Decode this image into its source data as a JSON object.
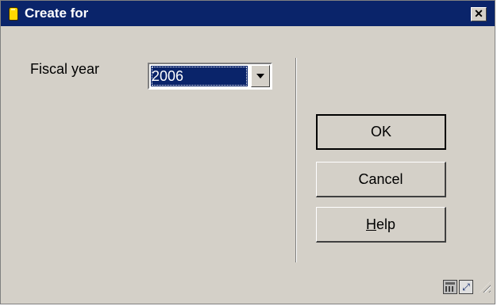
{
  "window": {
    "title": "Create for",
    "close_glyph": "✕"
  },
  "form": {
    "fiscal_year_label": "Fiscal year",
    "fiscal_year_value": "2006"
  },
  "buttons": {
    "ok": "OK",
    "cancel": "Cancel",
    "help_mnemonic": "H",
    "help_rest": "elp"
  },
  "statusbar": {
    "icons": [
      "keyboard-icon",
      "expand-icon"
    ]
  },
  "colors": {
    "titlebar": "#0a246a",
    "face": "#d4d0c8",
    "selection": "#0a246a"
  }
}
